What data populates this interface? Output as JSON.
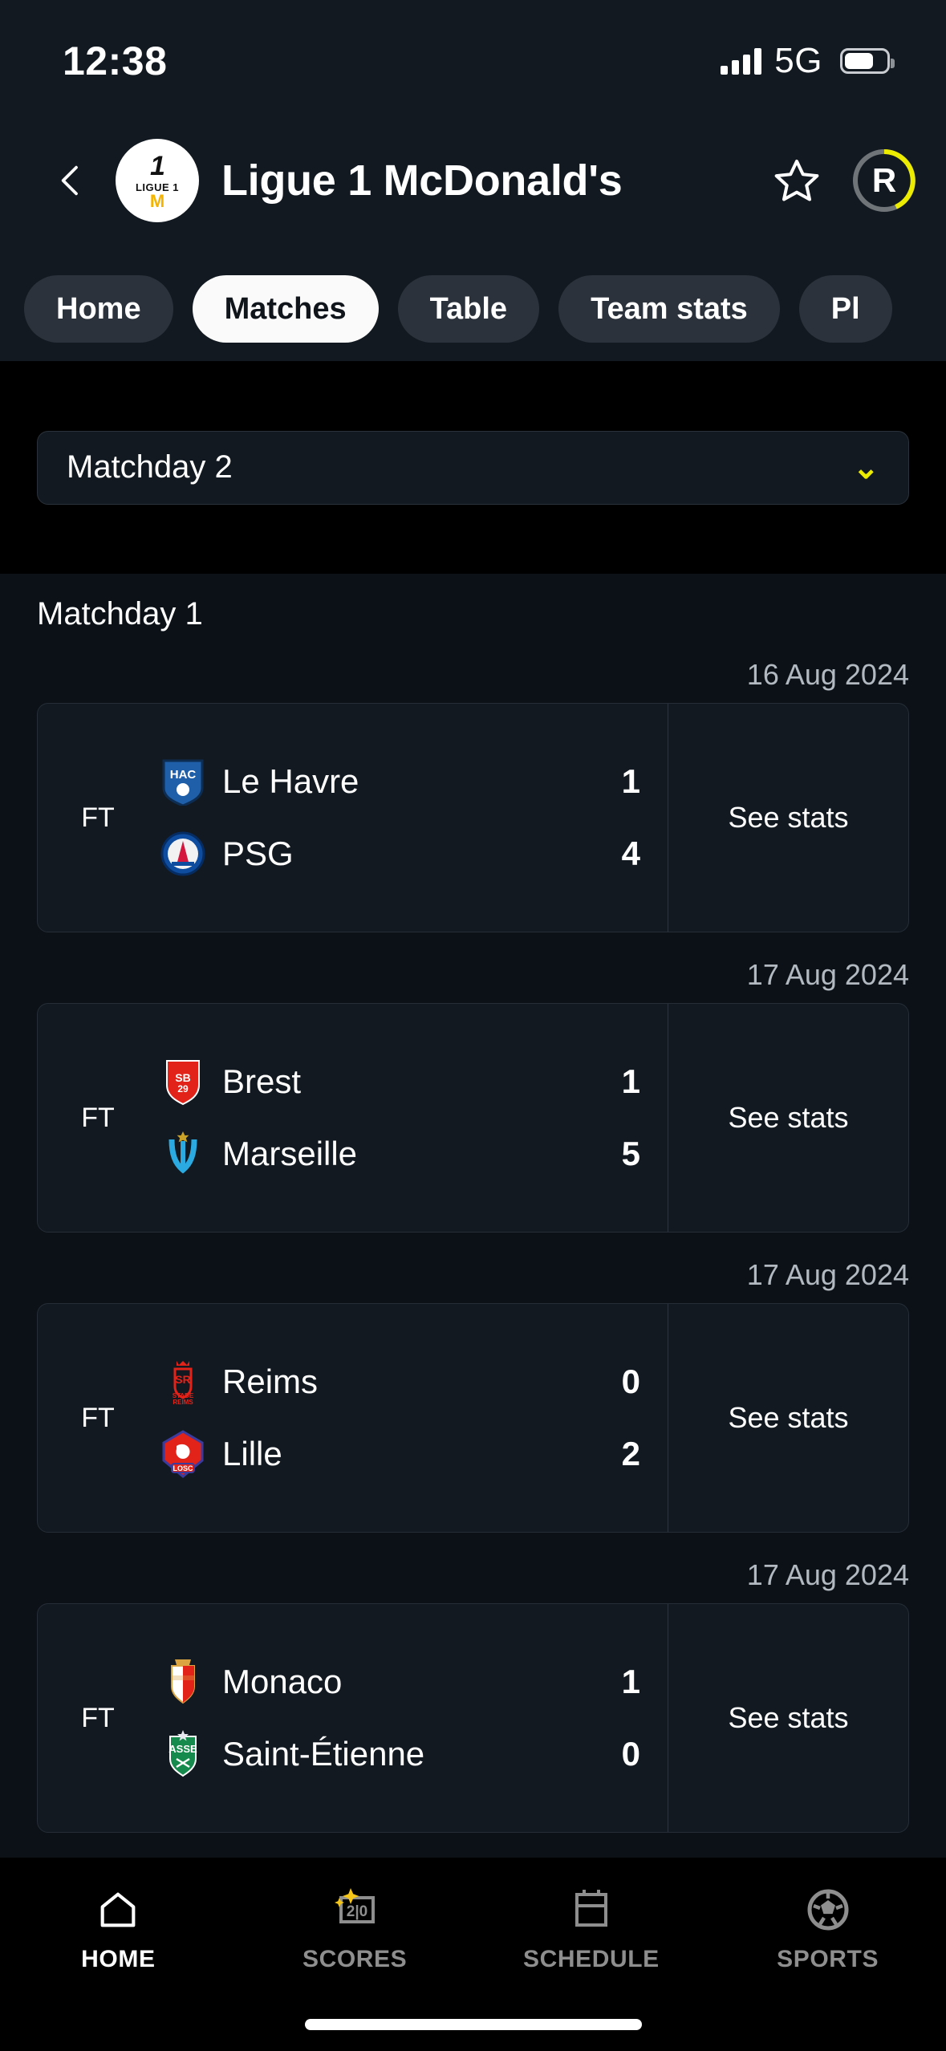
{
  "status_bar": {
    "time": "12:38",
    "network": "5G",
    "signal_icon": "signal-bars-icon",
    "battery_icon": "battery-icon"
  },
  "header": {
    "back_icon": "chevron-left-icon",
    "league_badge": {
      "icon": "ligue1-mcdonalds-badge-icon",
      "number": "1",
      "subtitle": "LIGUE 1",
      "sponsor": "M"
    },
    "title": "Ligue 1 McDonald's",
    "favourite_icon": "star-outline-icon",
    "avatar": {
      "letter": "R",
      "ring_color": "#ecec00",
      "ring_track_color": "#6f7479"
    }
  },
  "tabs": [
    {
      "label": "Home",
      "active": false
    },
    {
      "label": "Matches",
      "active": true
    },
    {
      "label": "Table",
      "active": false
    },
    {
      "label": "Team stats",
      "active": false
    },
    {
      "label": "Pl",
      "active": false
    }
  ],
  "matchday_select": {
    "value": "Matchday 2",
    "chevron_icon": "chevron-down-icon",
    "chevron_glyph": "⌄"
  },
  "section": {
    "heading": "Matchday 1"
  },
  "matches": [
    {
      "date": "16 Aug 2024",
      "status": "FT",
      "home": {
        "name": "Le Havre",
        "score": "1",
        "crest": "le-havre-crest-icon"
      },
      "away": {
        "name": "PSG",
        "score": "4",
        "crest": "psg-crest-icon"
      },
      "action": "See stats"
    },
    {
      "date": "17 Aug 2024",
      "status": "FT",
      "home": {
        "name": "Brest",
        "score": "1",
        "crest": "brest-crest-icon"
      },
      "away": {
        "name": "Marseille",
        "score": "5",
        "crest": "marseille-crest-icon"
      },
      "action": "See stats"
    },
    {
      "date": "17 Aug 2024",
      "status": "FT",
      "home": {
        "name": "Reims",
        "score": "0",
        "crest": "reims-crest-icon"
      },
      "away": {
        "name": "Lille",
        "score": "2",
        "crest": "lille-crest-icon"
      },
      "action": "See stats"
    },
    {
      "date": "17 Aug 2024",
      "status": "FT",
      "home": {
        "name": "Monaco",
        "score": "1",
        "crest": "monaco-crest-icon"
      },
      "away": {
        "name": "Saint-Étienne",
        "score": "0",
        "crest": "saint-etienne-crest-icon"
      },
      "action": "See stats"
    }
  ],
  "bottom_nav": [
    {
      "label": "HOME",
      "icon": "home-icon",
      "active": true
    },
    {
      "label": "SCORES",
      "icon": "scoreboard-sparkle-icon",
      "active": false,
      "score_text": "2|0"
    },
    {
      "label": "SCHEDULE",
      "icon": "calendar-icon",
      "active": false
    },
    {
      "label": "SPORTS",
      "icon": "soccer-ball-icon",
      "active": false
    }
  ],
  "colors": {
    "page_black": "#000000",
    "surface": "#121920",
    "content_bg": "#0b1117",
    "accent_yellow": "#ecec00",
    "muted_text": "#b3b9c0"
  }
}
